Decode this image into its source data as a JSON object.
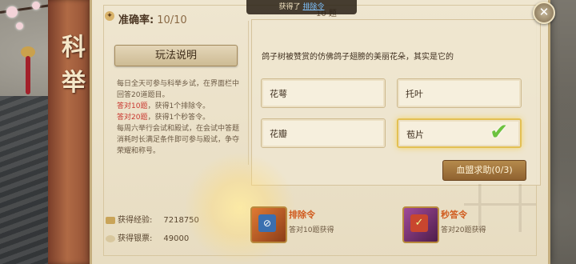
{
  "scroll": {
    "chars": [
      "科",
      "举"
    ]
  },
  "header": {
    "accuracy_label": "准确率:",
    "accuracy_value": "10/10",
    "title_behind": "10 题"
  },
  "toast": {
    "prefix": "获得了",
    "item": "排除令"
  },
  "rules": {
    "button_label": "玩法说明",
    "text_1": "每日全天可参与科举乡试，在界面栏中回答20道题目。",
    "reward_1_cond": "答对10题",
    "reward_1_text": "，获得1个排除令。",
    "reward_2_cond": "答对20题",
    "reward_2_text": "，获得1个秒答令。",
    "text_2": "每周六举行会试和殿试，在会试中答题消耗时长满足条件即可参与殿试，争夺荣耀和称号。"
  },
  "stats": {
    "exp_label": "获得经验:",
    "exp_value": "7218750",
    "silver_label": "获得银票:",
    "silver_value": "49000"
  },
  "question": {
    "text": "鸽子树被赞赏的仿佛鸽子翅膀的美丽花朵，其实是它的",
    "options": [
      "花萼",
      "托叶",
      "花瓣",
      "苞片"
    ],
    "correct_index": 3
  },
  "help_button": "血盟求助(0/3)",
  "rewards": [
    {
      "name": "排除令",
      "desc": "答对10题获得",
      "icon": "exclusion-token-icon",
      "color": "#c0642a"
    },
    {
      "name": "秒答令",
      "desc": "答对20题获得",
      "icon": "instant-answer-token-icon",
      "color": "#8a3a86"
    }
  ],
  "colors": {
    "accent_red": "#c9362e",
    "check_green": "#6cc23e",
    "highlight_gold": "#e3c053"
  }
}
